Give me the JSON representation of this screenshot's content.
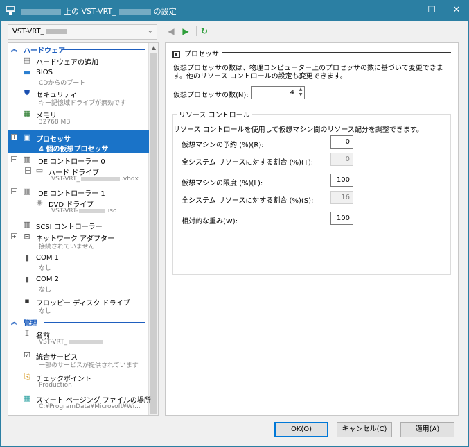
{
  "window": {
    "title_prefix": "上の VST-VRT_",
    "title_suffix": "の設定",
    "minimize_icon": "minimize-icon",
    "maximize_icon": "maximize-icon",
    "close_icon": "close-icon"
  },
  "vm_select": {
    "value": "VST-VRT_"
  },
  "toolbar": {
    "back_icon": "back-icon",
    "forward_icon": "forward-icon",
    "refresh_icon": "refresh-icon"
  },
  "tree": {
    "hardware_section": "ハードウェア",
    "management_section": "管理",
    "items": {
      "add_hardware": {
        "label": "ハードウェアの追加"
      },
      "bios": {
        "label": "BIOS",
        "sub": "CDからのブート"
      },
      "security": {
        "label": "セキュリティ",
        "sub": "キー記憶域ドライブが無効です"
      },
      "memory": {
        "label": "メモリ",
        "sub": "32768 MB"
      },
      "processor": {
        "label": "プロセッサ",
        "sub": "4 個の仮想プロセッサ"
      },
      "ide0": {
        "label": "IDE コントローラー 0"
      },
      "hdd": {
        "label": "ハード ドライブ",
        "sub_prefix": "VST-VRT_",
        "sub_suffix": ".vhdx"
      },
      "ide1": {
        "label": "IDE コントローラー 1"
      },
      "dvd": {
        "label": "DVD ドライブ",
        "sub_prefix": "VST-VRT-",
        "sub_suffix": ".iso"
      },
      "scsi": {
        "label": "SCSI コントローラー"
      },
      "network": {
        "label": "ネットワーク アダプター",
        "sub": "接続されていません"
      },
      "com1": {
        "label": "COM 1",
        "sub": "なし"
      },
      "com2": {
        "label": "COM 2",
        "sub": "なし"
      },
      "floppy": {
        "label": "フロッピー ディスク ドライブ",
        "sub": "なし"
      },
      "name": {
        "label": "名前",
        "sub_prefix": "VST-VRT_"
      },
      "integration": {
        "label": "統合サービス",
        "sub": "一部のサービスが提供されています"
      },
      "checkpoint": {
        "label": "チェックポイント",
        "sub": "Production"
      },
      "paging": {
        "label": "スマート ページング ファイルの場所",
        "sub": "C:¥ProgramData¥Microsoft¥Wi..."
      }
    }
  },
  "panel": {
    "title": "プロセッサ",
    "description": "仮想プロセッサの数は、物理コンピューター上のプロセッサの数に基づいて変更できます。他のリソース コントロールの設定も変更できます。",
    "vcpu_label": "仮想プロセッサの数(N):",
    "vcpu_value": "4",
    "resource_group_title": "リソース コントロール",
    "resource_desc": "リソース コントロールを使用して仮想マシン間のリソース配分を調整できます。",
    "reserve_label": "仮想マシンの予約 (%)(R):",
    "reserve_value": "0",
    "reserve_pct_label": "全システム リソースに対する割合 (%)(T):",
    "reserve_pct_value": "0",
    "limit_label": "仮想マシンの限度 (%)(L):",
    "limit_value": "100",
    "limit_pct_label": "全システム リソースに対する割合 (%)(S):",
    "limit_pct_value": "16",
    "weight_label": "相対的な重み(W):",
    "weight_value": "100"
  },
  "buttons": {
    "ok": "OK(O)",
    "cancel": "キャンセル(C)",
    "apply": "適用(A)"
  }
}
